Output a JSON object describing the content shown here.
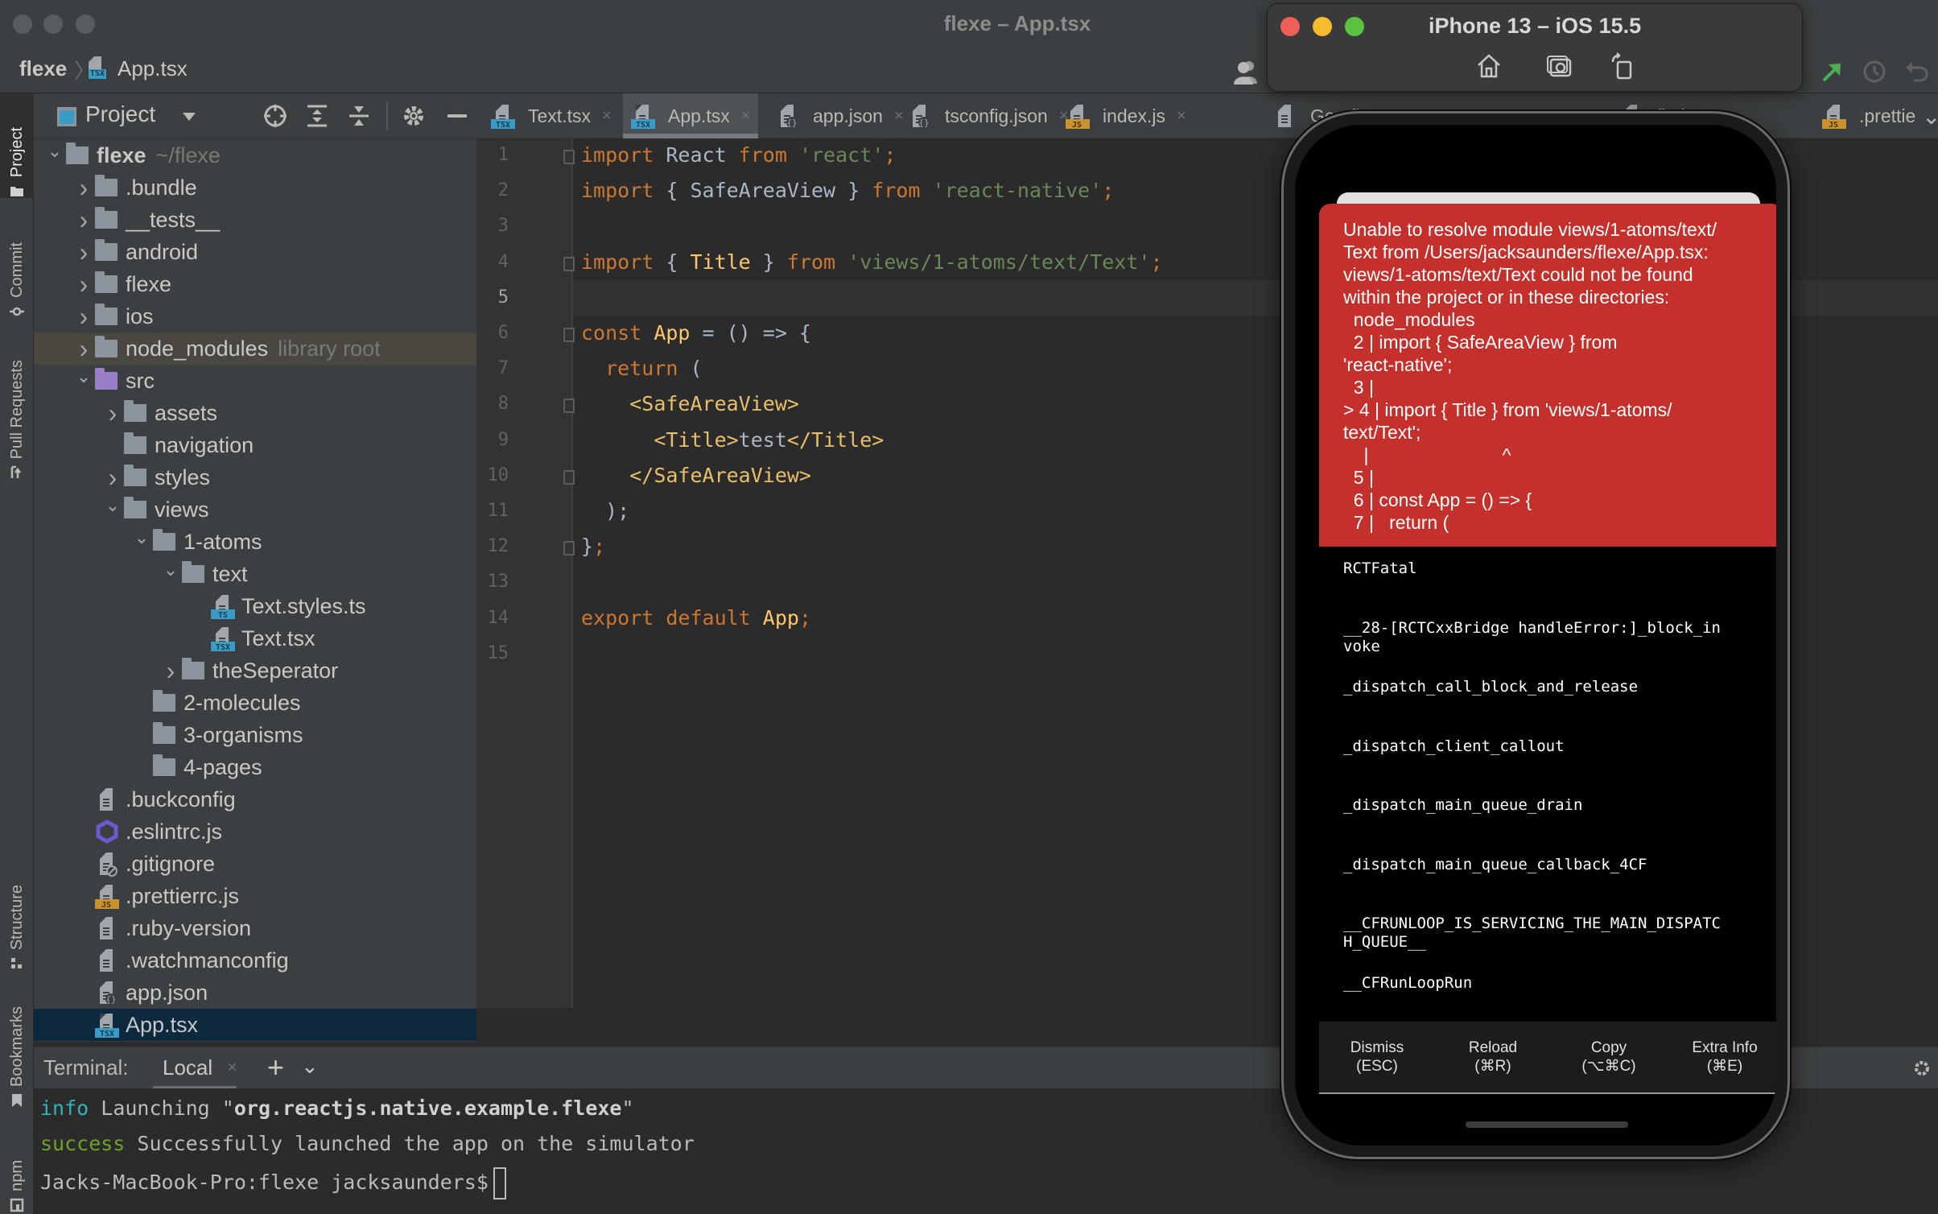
{
  "window": {
    "title": "flexe – App.tsx"
  },
  "breadcrumb": {
    "root": "flexe",
    "file": "App.tsx",
    "file_badge": "TSX"
  },
  "toolstrip": {
    "items": [
      {
        "label": "Project",
        "icon": "folder-icon",
        "active": true
      },
      {
        "label": "Commit",
        "icon": "commit-icon",
        "active": false
      },
      {
        "label": "Pull Requests",
        "icon": "pull-request-icon",
        "active": false
      },
      {
        "label": "Structure",
        "icon": "structure-icon",
        "active": false
      },
      {
        "label": "Bookmarks",
        "icon": "bookmark-icon",
        "active": false
      },
      {
        "label": "npm",
        "icon": "npm-icon",
        "active": false
      }
    ]
  },
  "project_panel": {
    "title": "Project",
    "tree": [
      {
        "label": "flexe",
        "suffix": "~/flexe",
        "type": "folder",
        "depth": 0,
        "expanded": true,
        "bold": true
      },
      {
        "label": ".bundle",
        "type": "folder",
        "depth": 1,
        "expanded": false
      },
      {
        "label": "__tests__",
        "type": "folder",
        "depth": 1,
        "expanded": false
      },
      {
        "label": "android",
        "type": "folder",
        "depth": 1,
        "expanded": false
      },
      {
        "label": "flexe",
        "type": "folder",
        "depth": 1,
        "expanded": false
      },
      {
        "label": "ios",
        "type": "folder",
        "depth": 1,
        "expanded": false
      },
      {
        "label": "node_modules",
        "suffix": "library root",
        "type": "folder",
        "depth": 1,
        "expanded": false,
        "library": true
      },
      {
        "label": "src",
        "type": "folder-purple",
        "depth": 1,
        "expanded": true
      },
      {
        "label": "assets",
        "type": "folder",
        "depth": 2,
        "expanded": false
      },
      {
        "label": "navigation",
        "type": "folder",
        "depth": 2,
        "expanded": null
      },
      {
        "label": "styles",
        "type": "folder",
        "depth": 2,
        "expanded": false
      },
      {
        "label": "views",
        "type": "folder",
        "depth": 2,
        "expanded": true
      },
      {
        "label": "1-atoms",
        "type": "folder",
        "depth": 3,
        "expanded": true
      },
      {
        "label": "text",
        "type": "folder",
        "depth": 4,
        "expanded": true
      },
      {
        "label": "Text.styles.ts",
        "type": "ts",
        "depth": 5
      },
      {
        "label": "Text.tsx",
        "type": "tsx",
        "depth": 5
      },
      {
        "label": "theSeperator",
        "type": "folder",
        "depth": 4,
        "expanded": false
      },
      {
        "label": "2-molecules",
        "type": "folder",
        "depth": 3,
        "expanded": null
      },
      {
        "label": "3-organisms",
        "type": "folder",
        "depth": 3,
        "expanded": null
      },
      {
        "label": "4-pages",
        "type": "folder",
        "depth": 3,
        "expanded": null
      },
      {
        "label": ".buckconfig",
        "type": "text",
        "depth": 1
      },
      {
        "label": ".eslintrc.js",
        "type": "eslint",
        "depth": 1
      },
      {
        "label": ".gitignore",
        "type": "ignore",
        "depth": 1
      },
      {
        "label": ".prettierrc.js",
        "type": "js",
        "depth": 1
      },
      {
        "label": ".ruby-version",
        "type": "text",
        "depth": 1
      },
      {
        "label": ".watchmanconfig",
        "type": "text",
        "depth": 1
      },
      {
        "label": "app.json",
        "type": "json",
        "depth": 1
      },
      {
        "label": "App.tsx",
        "type": "tsx",
        "depth": 1,
        "selected": true
      }
    ]
  },
  "tabs": [
    {
      "label": "Text.tsx",
      "type": "tsx",
      "active": false
    },
    {
      "label": "App.tsx",
      "type": "tsx",
      "active": true
    },
    {
      "label": "app.json",
      "type": "json",
      "active": false
    },
    {
      "label": "tsconfig.json",
      "type": "json",
      "active": false
    },
    {
      "label": "index.js",
      "type": "js",
      "active": false
    },
    {
      "label": "Gemfi",
      "type": "text",
      "active": false
    },
    {
      "label": "fig.js",
      "type": "js",
      "active": false
    },
    {
      "label": ".prettie",
      "type": "js",
      "active": false
    }
  ],
  "editor": {
    "current_line": 5,
    "lines": [
      {
        "n": "1",
        "tokens": [
          [
            "kw",
            "import"
          ],
          [
            "plain",
            " React "
          ],
          [
            "kw",
            "from"
          ],
          [
            "plain",
            " "
          ],
          [
            "str",
            "'react'"
          ],
          [
            "kw",
            ";"
          ]
        ]
      },
      {
        "n": "2",
        "tokens": [
          [
            "kw",
            "import"
          ],
          [
            "plain",
            " { SafeAreaView } "
          ],
          [
            "kw",
            "from"
          ],
          [
            "plain",
            " "
          ],
          [
            "str",
            "'react-native'"
          ],
          [
            "kw",
            ";"
          ]
        ]
      },
      {
        "n": "3",
        "tokens": []
      },
      {
        "n": "4",
        "tokens": [
          [
            "kw",
            "import"
          ],
          [
            "plain",
            " { "
          ],
          [
            "ident",
            "Title"
          ],
          [
            "plain",
            " } "
          ],
          [
            "kw",
            "from"
          ],
          [
            "plain",
            " "
          ],
          [
            "str",
            "'views/1-atoms/text/Text'"
          ],
          [
            "kw",
            ";"
          ]
        ]
      },
      {
        "n": "5",
        "tokens": []
      },
      {
        "n": "6",
        "tokens": [
          [
            "kw",
            "const "
          ],
          [
            "ident",
            "App"
          ],
          [
            "plain",
            " = () => {"
          ]
        ]
      },
      {
        "n": "7",
        "tokens": [
          [
            "plain",
            "  "
          ],
          [
            "kw",
            "return"
          ],
          [
            "plain",
            " ("
          ]
        ]
      },
      {
        "n": "8",
        "tokens": [
          [
            "plain",
            "    "
          ],
          [
            "tag",
            "<SafeAreaView>"
          ]
        ]
      },
      {
        "n": "9",
        "tokens": [
          [
            "plain",
            "      "
          ],
          [
            "tag",
            "<Title>"
          ],
          [
            "plain",
            "test"
          ],
          [
            "tag",
            "</Title>"
          ]
        ]
      },
      {
        "n": "10",
        "tokens": [
          [
            "plain",
            "    "
          ],
          [
            "tag",
            "</SafeAreaView>"
          ]
        ]
      },
      {
        "n": "11",
        "tokens": [
          [
            "plain",
            "  );"
          ]
        ]
      },
      {
        "n": "12",
        "tokens": [
          [
            "plain",
            "}"
          ],
          [
            "kw",
            ";"
          ]
        ]
      },
      {
        "n": "13",
        "tokens": []
      },
      {
        "n": "14",
        "tokens": [
          [
            "kw",
            "export default "
          ],
          [
            "ident",
            "App"
          ],
          [
            "kw",
            ";"
          ]
        ]
      },
      {
        "n": "15",
        "tokens": []
      }
    ]
  },
  "terminal": {
    "title": "Terminal:",
    "tab": "Local",
    "lines": [
      {
        "prefix": "info",
        "prefix_class": "t-info",
        "text": " Launching \"",
        "bold": "org.reactjs.native.example.flexe",
        "after": "\""
      },
      {
        "prefix": "success",
        "prefix_class": "t-success",
        "text": " Successfully launched the app on the simulator",
        "bold": "",
        "after": ""
      },
      {
        "prefix": "",
        "prefix_class": "",
        "text": "Jacks-MacBook-Pro:flexe jacksaunders$",
        "bold": "",
        "after": ""
      }
    ]
  },
  "simulator": {
    "title": "iPhone 13 – iOS 15.5",
    "error": {
      "lines": [
        "Unable to resolve module views/1-atoms/text/",
        "Text from /Users/jacksaunders/flexe/App.tsx:",
        "views/1-atoms/text/Text could not be found",
        "within the project or in these directories:",
        "  node_modules",
        "  2 | import { SafeAreaView } from",
        "'react-native';",
        "  3 |",
        "> 4 | import { Title } from 'views/1-atoms/",
        "text/Text';",
        "    |                          ^",
        "  5 |",
        "  6 | const App = () => {",
        "  7 |   return ("
      ]
    },
    "stack": [
      "RCTFatal",
      "__28-[RCTCxxBridge handleError:]_block_in\nvoke",
      "_dispatch_call_block_and_release",
      "_dispatch_client_callout",
      "_dispatch_main_queue_drain",
      "_dispatch_main_queue_callback_4CF",
      "__CFRUNLOOP_IS_SERVICING_THE_MAIN_DISPATC\nH_QUEUE__",
      "__CFRunLoopRun"
    ],
    "buttons": [
      {
        "label": "Dismiss",
        "shortcut": "(ESC)"
      },
      {
        "label": "Reload",
        "shortcut": "(⌘R)"
      },
      {
        "label": "Copy",
        "shortcut": "(⌥⌘C)"
      },
      {
        "label": "Extra Info",
        "shortcut": "(⌘E)"
      }
    ]
  },
  "colors": {
    "error_red": "#c4302b",
    "keyword": "#cc7832",
    "string": "#6a8759",
    "identifier": "#ffc66d",
    "tag": "#e8bf6a",
    "selection": "#0d293e",
    "info": "#2fb5b5",
    "success": "#6ba32b"
  }
}
